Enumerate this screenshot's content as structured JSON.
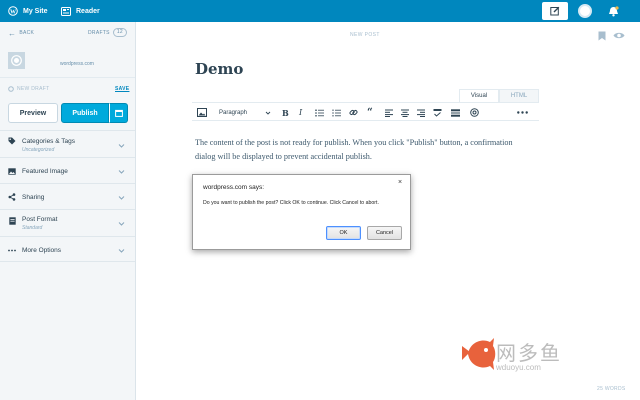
{
  "topbar": {
    "my_site": "My Site",
    "reader": "Reader",
    "icons": [
      "wordpress-icon",
      "reader-icon",
      "write-icon",
      "avatar",
      "notifications-icon"
    ]
  },
  "sidebar": {
    "back": "BACK",
    "drafts": "DRAFTS",
    "drafts_count": "12",
    "site_domain": "wordpress.com",
    "new_draft": "NEW DRAFT",
    "save": "SAVE",
    "preview": "Preview",
    "publish": "Publish",
    "items": [
      {
        "label": "Categories & Tags",
        "sub": "Uncategorized",
        "icon": "tag-icon"
      },
      {
        "label": "Featured Image",
        "sub": "",
        "icon": "image-icon"
      },
      {
        "label": "Sharing",
        "sub": "",
        "icon": "share-icon"
      },
      {
        "label": "Post Format",
        "sub": "Standard",
        "icon": "document-icon"
      },
      {
        "label": "More Options",
        "sub": "",
        "icon": "ellipsis-icon"
      }
    ]
  },
  "editor": {
    "new_post": "NEW POST",
    "title": "Demo",
    "tabs": [
      "Visual",
      "HTML"
    ],
    "format": "Paragraph",
    "body": "The content of the post is not ready for publish. When you click \"Publish\" button, a confirmation dialog will be displayed to prevent accidental publish.",
    "word_count": "25 WORDS"
  },
  "dialog": {
    "title": "wordpress.com says:",
    "message": "Do you want to publish the post? Click OK to continue. Click Cancel to abort.",
    "ok": "OK",
    "cancel": "Cancel",
    "close": "×"
  },
  "watermark": {
    "text": "网多鱼",
    "url": "wduoyu.com"
  },
  "colors": {
    "masterbar": "#0087be",
    "publish": "#00aadc",
    "sidebar_bg": "#f3f6f8"
  }
}
